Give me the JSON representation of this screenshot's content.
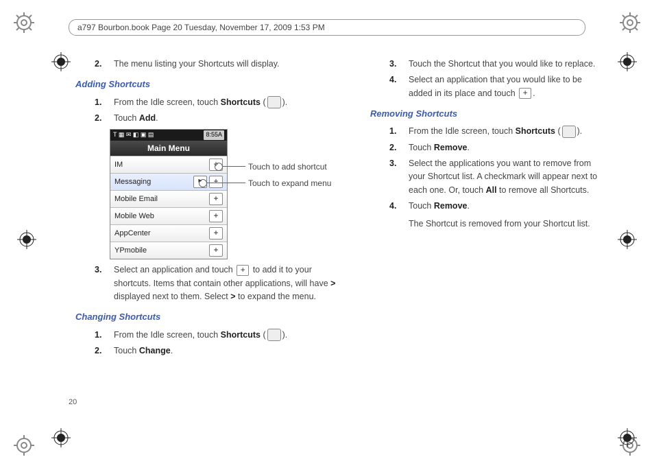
{
  "header": {
    "text": "a797 Bourbon.book  Page 20  Tuesday, November 17, 2009  1:53 PM"
  },
  "page_number": "20",
  "left": {
    "step2_intro": "The menu listing your Shortcuts will display.",
    "adding_heading": "Adding Shortcuts",
    "adding": {
      "s1_pre": "From the Idle screen, touch ",
      "s1_bold": "Shortcuts",
      "s1_post": " (",
      "s1_end": ").",
      "s2_pre": "Touch ",
      "s2_bold": "Add",
      "s2_post": ".",
      "s3_a": "Select an application and touch ",
      "s3_b": " to add it to your shortcuts. Items that contain other applications, will have ",
      "s3_gt": ">",
      "s3_c": " displayed next to them. Select ",
      "s3_gt2": ">",
      "s3_d": " to expand the menu."
    },
    "changing_heading": "Changing Shortcuts",
    "changing": {
      "s1_pre": "From the Idle screen, touch ",
      "s1_bold": "Shortcuts",
      "s1_post": " (",
      "s1_end": ").",
      "s2_pre": "Touch ",
      "s2_bold": "Change",
      "s2_post": "."
    },
    "phone": {
      "status_left": "T ▦ ✉ ◧ ▣ ▤",
      "status_right": "8:55A",
      "title": "Main Menu",
      "rows": [
        "IM",
        "Messaging",
        "Mobile Email",
        "Mobile Web",
        "AppCenter",
        "YPmobile"
      ]
    },
    "callout1": "Touch to add shortcut",
    "callout2": "Touch to expand menu"
  },
  "right": {
    "s3": "Touch the Shortcut that you would like to replace.",
    "s4_a": "Select an application that you would like to be added in its place and touch ",
    "s4_b": ".",
    "removing_heading": "Removing Shortcuts",
    "removing": {
      "s1_pre": "From the Idle screen, touch ",
      "s1_bold": "Shortcuts",
      "s1_post": " (",
      "s1_end": ").",
      "s2_pre": "Touch ",
      "s2_bold": "Remove",
      "s2_post": ".",
      "s3_a": "Select the applications you want to remove from your Shortcut list. A checkmark will appear next to each one. Or, touch ",
      "s3_bold": "All",
      "s3_b": " to remove all Shortcuts.",
      "s4_pre": "Touch ",
      "s4_bold": "Remove",
      "s4_post": ".",
      "s4_result": "The Shortcut is removed from your Shortcut list."
    }
  },
  "nums": {
    "n1": "1.",
    "n2": "2.",
    "n3": "3.",
    "n4": "4."
  }
}
